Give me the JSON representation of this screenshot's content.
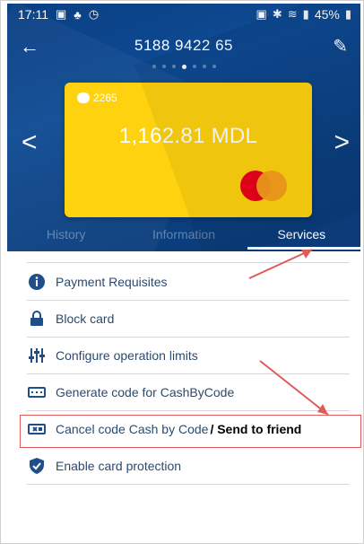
{
  "status_bar": {
    "time": "17:11",
    "battery": "45%"
  },
  "top_bar": {
    "card_number": "5188 9422 65"
  },
  "card": {
    "tag": "2265",
    "balance": "1,162.81 MDL",
    "brand_icon": "mastercard-logo"
  },
  "tabs": [
    {
      "label": "History",
      "active": false
    },
    {
      "label": "Information",
      "active": false
    },
    {
      "label": "Services",
      "active": true
    }
  ],
  "services": [
    {
      "icon": "info-icon",
      "label": "Payment Requisites"
    },
    {
      "icon": "lock-icon",
      "label": "Block card"
    },
    {
      "icon": "sliders-icon",
      "label": "Configure operation limits"
    },
    {
      "icon": "code-card-icon",
      "label": "Generate code for CashByCode"
    },
    {
      "icon": "cancel-code-icon",
      "label": "Cancel code Cash by Code",
      "suffix": "/ Send to friend"
    },
    {
      "icon": "shield-check-icon",
      "label": "Enable card protection"
    }
  ],
  "colors": {
    "header": "#0b3f7f",
    "card": "#ffd20f",
    "list_text": "#2b4a6f",
    "annotation": "#e05a5a"
  }
}
